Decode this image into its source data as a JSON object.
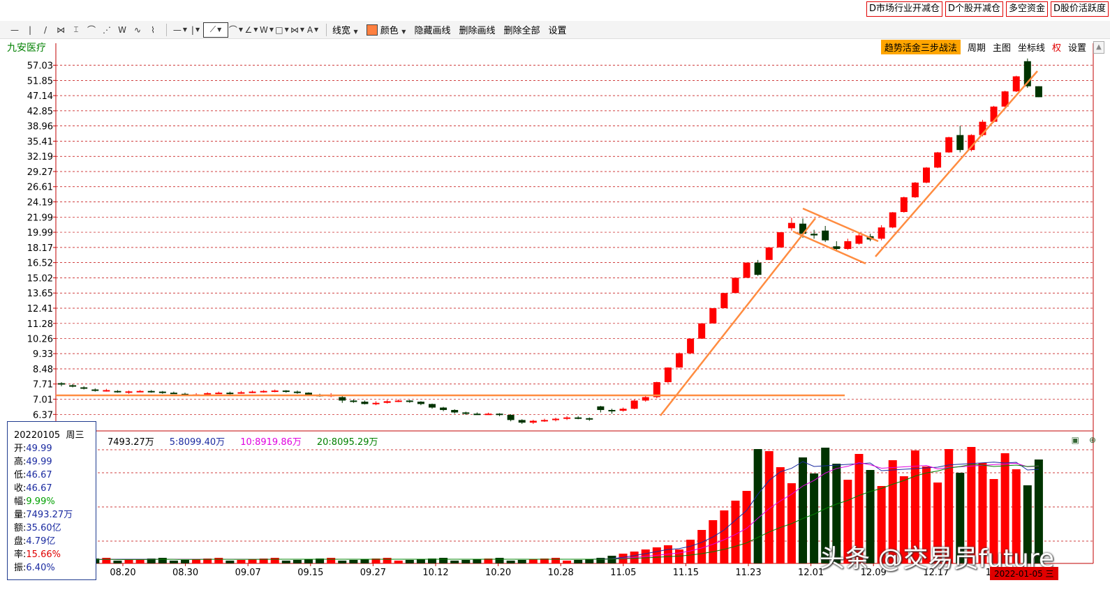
{
  "top_buttons": [
    "D市场行业开减仓",
    "D个股开减仓",
    "多空资金",
    "D股价活跃度"
  ],
  "toolbar": {
    "line_width_label": "线宽",
    "color_label": "颜色",
    "hide_label": "隐藏画线",
    "delete_label": "删除画线",
    "delete_all_label": "删除全部",
    "settings_label": "设置",
    "color_swatch": "#ff8040"
  },
  "stock_name": "九安医疗",
  "controls": {
    "strategy": "趋势活金三步战法",
    "period": "周期",
    "main_chart": "主图",
    "axis": "坐标线",
    "rights": "权",
    "settings": "设置"
  },
  "price_axis_labels": [
    "57.03",
    "51.85",
    "47.14",
    "42.85",
    "38.96",
    "35.41",
    "32.19",
    "29.27",
    "26.61",
    "24.19",
    "21.99",
    "19.99",
    "18.17",
    "16.52",
    "15.02",
    "13.65",
    "12.41",
    "11.28",
    "10.26",
    "9.33",
    "8.48",
    "7.71",
    "7.01",
    "6.37"
  ],
  "date_axis_labels": [
    "08.20",
    "08.30",
    "09.07",
    "09.15",
    "09.27",
    "10.12",
    "10.20",
    "10.28",
    "11.05",
    "11.15",
    "11.23",
    "12.01",
    "12.09",
    "12.17",
    "12.27"
  ],
  "info": {
    "date": "20220105",
    "weekday": "周三",
    "open_label": "开:",
    "open": "49.99",
    "high_label": "高:",
    "high": "49.99",
    "low_label": "低:",
    "low": "46.67",
    "close_label": "收:",
    "close": "46.67",
    "change_label": "幅:",
    "change": "9.99%",
    "volume_label": "量:",
    "volume": "7493.27万",
    "amount_label": "额:",
    "amount": "35.60亿",
    "float_label": "盘:",
    "float": "4.79亿",
    "turnover_label": "率:",
    "turnover": "15.66%",
    "amplitude_label": "振:",
    "amplitude": "6.40%"
  },
  "volume_legend": {
    "vol": "7493.27万",
    "ma5": "5:8099.40万",
    "ma10": "10:8919.86万",
    "ma20": "20:8095.29万"
  },
  "watermark": "头条 @交易员future",
  "date_badge": "2022-01-05 三",
  "colors": {
    "up": "#ff0000",
    "down": "#003300",
    "grid": "#c00000",
    "drawing": "#ff8c40"
  },
  "chart_data": {
    "type": "candlestick",
    "scale": "log",
    "ylim": [
      6.0,
      60.0
    ],
    "candles": [
      [
        7.75,
        7.7,
        7.8,
        7.6
      ],
      [
        7.65,
        7.6,
        7.7,
        7.55
      ],
      [
        7.55,
        7.5,
        7.6,
        7.45
      ],
      [
        7.45,
        7.4,
        7.5,
        7.35
      ],
      [
        7.4,
        7.42,
        7.48,
        7.35
      ],
      [
        7.38,
        7.35,
        7.42,
        7.3
      ],
      [
        7.35,
        7.36,
        7.4,
        7.25
      ],
      [
        7.36,
        7.38,
        7.42,
        7.32
      ],
      [
        7.38,
        7.35,
        7.42,
        7.3
      ],
      [
        7.35,
        7.3,
        7.38,
        7.25
      ],
      [
        7.3,
        7.28,
        7.35,
        7.25
      ],
      [
        7.25,
        7.2,
        7.3,
        7.15
      ],
      [
        7.2,
        7.22,
        7.28,
        7.15
      ],
      [
        7.22,
        7.28,
        7.32,
        7.18
      ],
      [
        7.28,
        7.3,
        7.35,
        7.25
      ],
      [
        7.3,
        7.28,
        7.35,
        7.22
      ],
      [
        7.28,
        7.32,
        7.38,
        7.25
      ],
      [
        7.32,
        7.35,
        7.4,
        7.28
      ],
      [
        7.36,
        7.38,
        7.42,
        7.3
      ],
      [
        7.38,
        7.4,
        7.45,
        7.32
      ],
      [
        7.4,
        7.35,
        7.42,
        7.3
      ],
      [
        7.35,
        7.3,
        7.4,
        7.25
      ],
      [
        7.3,
        7.2,
        7.32,
        7.15
      ],
      [
        7.2,
        7.18,
        7.25,
        7.12
      ],
      [
        7.15,
        7.2,
        7.28,
        7.1
      ],
      [
        7.1,
        6.95,
        7.15,
        6.85
      ],
      [
        6.95,
        6.9,
        7.0,
        6.85
      ],
      [
        6.9,
        6.8,
        6.95,
        6.78
      ],
      [
        6.8,
        6.85,
        6.92,
        6.75
      ],
      [
        6.85,
        6.92,
        6.98,
        6.82
      ],
      [
        6.92,
        6.95,
        7.0,
        6.88
      ],
      [
        6.95,
        6.9,
        6.98,
        6.85
      ],
      [
        6.9,
        6.8,
        6.92,
        6.75
      ],
      [
        6.8,
        6.65,
        6.82,
        6.6
      ],
      [
        6.65,
        6.55,
        6.68,
        6.5
      ],
      [
        6.55,
        6.45,
        6.58,
        6.4
      ],
      [
        6.45,
        6.4,
        6.48,
        6.35
      ],
      [
        6.4,
        6.38,
        6.45,
        6.35
      ],
      [
        6.38,
        6.4,
        6.44,
        6.35
      ],
      [
        6.4,
        6.35,
        6.42,
        6.3
      ],
      [
        6.35,
        6.15,
        6.38,
        6.1
      ],
      [
        6.15,
        6.05,
        6.18,
        6.0
      ],
      [
        6.05,
        6.12,
        6.16,
        6.0
      ],
      [
        6.12,
        6.15,
        6.2,
        6.08
      ],
      [
        6.15,
        6.2,
        6.24,
        6.1
      ],
      [
        6.2,
        6.25,
        6.3,
        6.15
      ],
      [
        6.25,
        6.22,
        6.3,
        6.18
      ],
      [
        6.22,
        6.18,
        6.25,
        6.12
      ],
      [
        6.7,
        6.55,
        6.72,
        6.45
      ],
      [
        6.55,
        6.52,
        6.6,
        6.4
      ],
      [
        6.52,
        6.6,
        6.65,
        6.48
      ],
      [
        6.6,
        6.95,
        7.0,
        6.58
      ],
      [
        6.95,
        7.1,
        7.15,
        6.9
      ],
      [
        7.1,
        7.8,
        7.82,
        7.05
      ],
      [
        7.8,
        8.55,
        8.56,
        7.75
      ],
      [
        8.55,
        9.35,
        9.4,
        8.55
      ],
      [
        9.35,
        10.25,
        10.26,
        9.3
      ],
      [
        10.25,
        11.28,
        11.28,
        10.25
      ],
      [
        11.28,
        12.41,
        12.41,
        11.28
      ],
      [
        12.41,
        13.65,
        13.65,
        12.41
      ],
      [
        13.65,
        15.02,
        15.02,
        13.65
      ],
      [
        15.02,
        16.52,
        16.52,
        15.02
      ],
      [
        16.52,
        15.3,
        16.8,
        15.2
      ],
      [
        16.8,
        18.17,
        18.17,
        16.8
      ],
      [
        18.17,
        19.99,
        19.99,
        18.17
      ],
      [
        20.5,
        21.2,
        21.9,
        20.2
      ],
      [
        21.1,
        19.8,
        21.8,
        19.3
      ],
      [
        19.8,
        19.6,
        20.3,
        19.2
      ],
      [
        20.2,
        19.0,
        20.8,
        18.8
      ],
      [
        18.3,
        18.0,
        18.9,
        17.7
      ],
      [
        18.0,
        18.9,
        19.2,
        17.9
      ],
      [
        18.6,
        19.6,
        19.9,
        18.5
      ],
      [
        19.5,
        19.1,
        19.8,
        18.9
      ],
      [
        19.2,
        20.6,
        20.9,
        19.0
      ],
      [
        20.6,
        22.65,
        22.7,
        20.5
      ],
      [
        22.7,
        24.9,
        25.0,
        22.6
      ],
      [
        24.9,
        27.3,
        27.4,
        24.8
      ],
      [
        27.3,
        30.0,
        30.1,
        27.2
      ],
      [
        30.0,
        33.0,
        33.1,
        29.9
      ],
      [
        33.0,
        36.3,
        36.4,
        32.9
      ],
      [
        36.8,
        33.5,
        39.0,
        33.0
      ],
      [
        33.5,
        36.8,
        37.0,
        33.2
      ],
      [
        36.8,
        40.0,
        40.5,
        36.5
      ],
      [
        40.0,
        44.0,
        44.2,
        39.8
      ],
      [
        44.0,
        48.4,
        48.6,
        43.8
      ],
      [
        48.4,
        53.2,
        53.4,
        48.2
      ],
      [
        58.5,
        49.99,
        59.5,
        49.5
      ],
      [
        49.99,
        46.67,
        49.99,
        46.67
      ]
    ],
    "volume_ylim": [
      0,
      15000
    ],
    "volumes": []
  }
}
